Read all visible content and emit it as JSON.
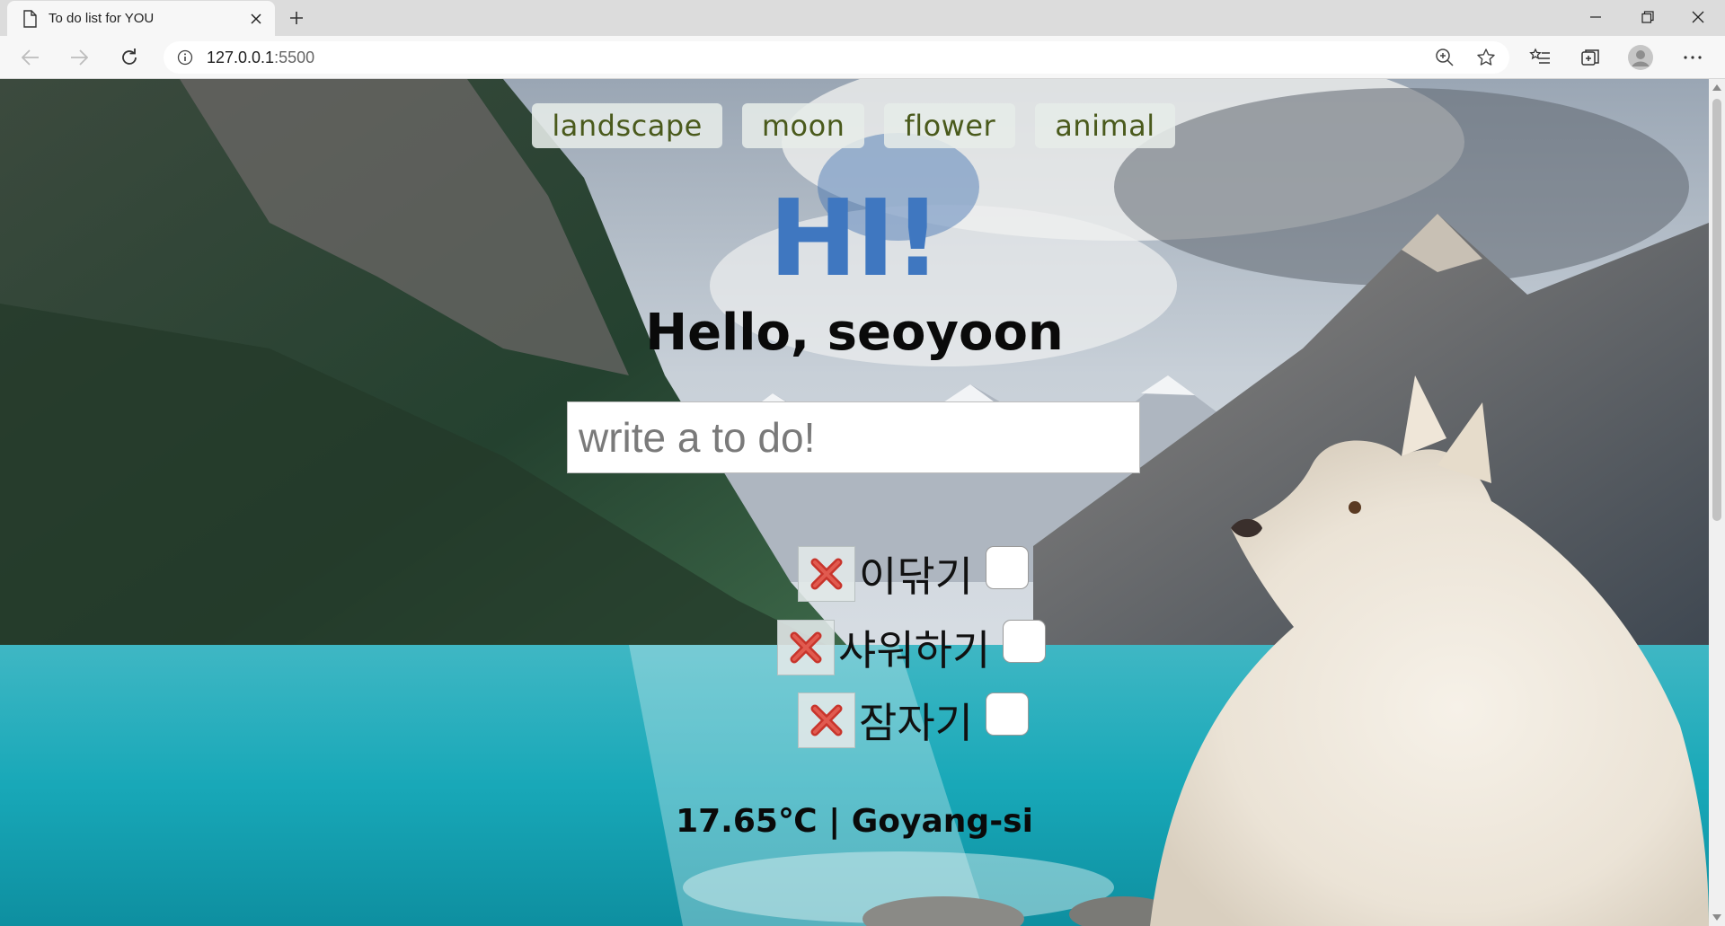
{
  "browser": {
    "tab_title": "To do list for YOU",
    "url_host": "127.0.0.1",
    "url_port": ":5500"
  },
  "page": {
    "categories": [
      "landscape",
      "moon",
      "flower",
      "animal"
    ],
    "greeting_big": "HI!",
    "greeting": "Hello, seoyoon",
    "todo_placeholder": "write a to do!",
    "todos": [
      {
        "text": "이닦기",
        "checked": false
      },
      {
        "text": "샤워하기",
        "checked": false
      },
      {
        "text": "잠자기",
        "checked": false
      }
    ],
    "weather": "17.65℃ | Goyang-si"
  },
  "colors": {
    "hi_blue": "#3f77c0",
    "delete_red": "#c8342b",
    "category_text": "#4a5a1c"
  }
}
